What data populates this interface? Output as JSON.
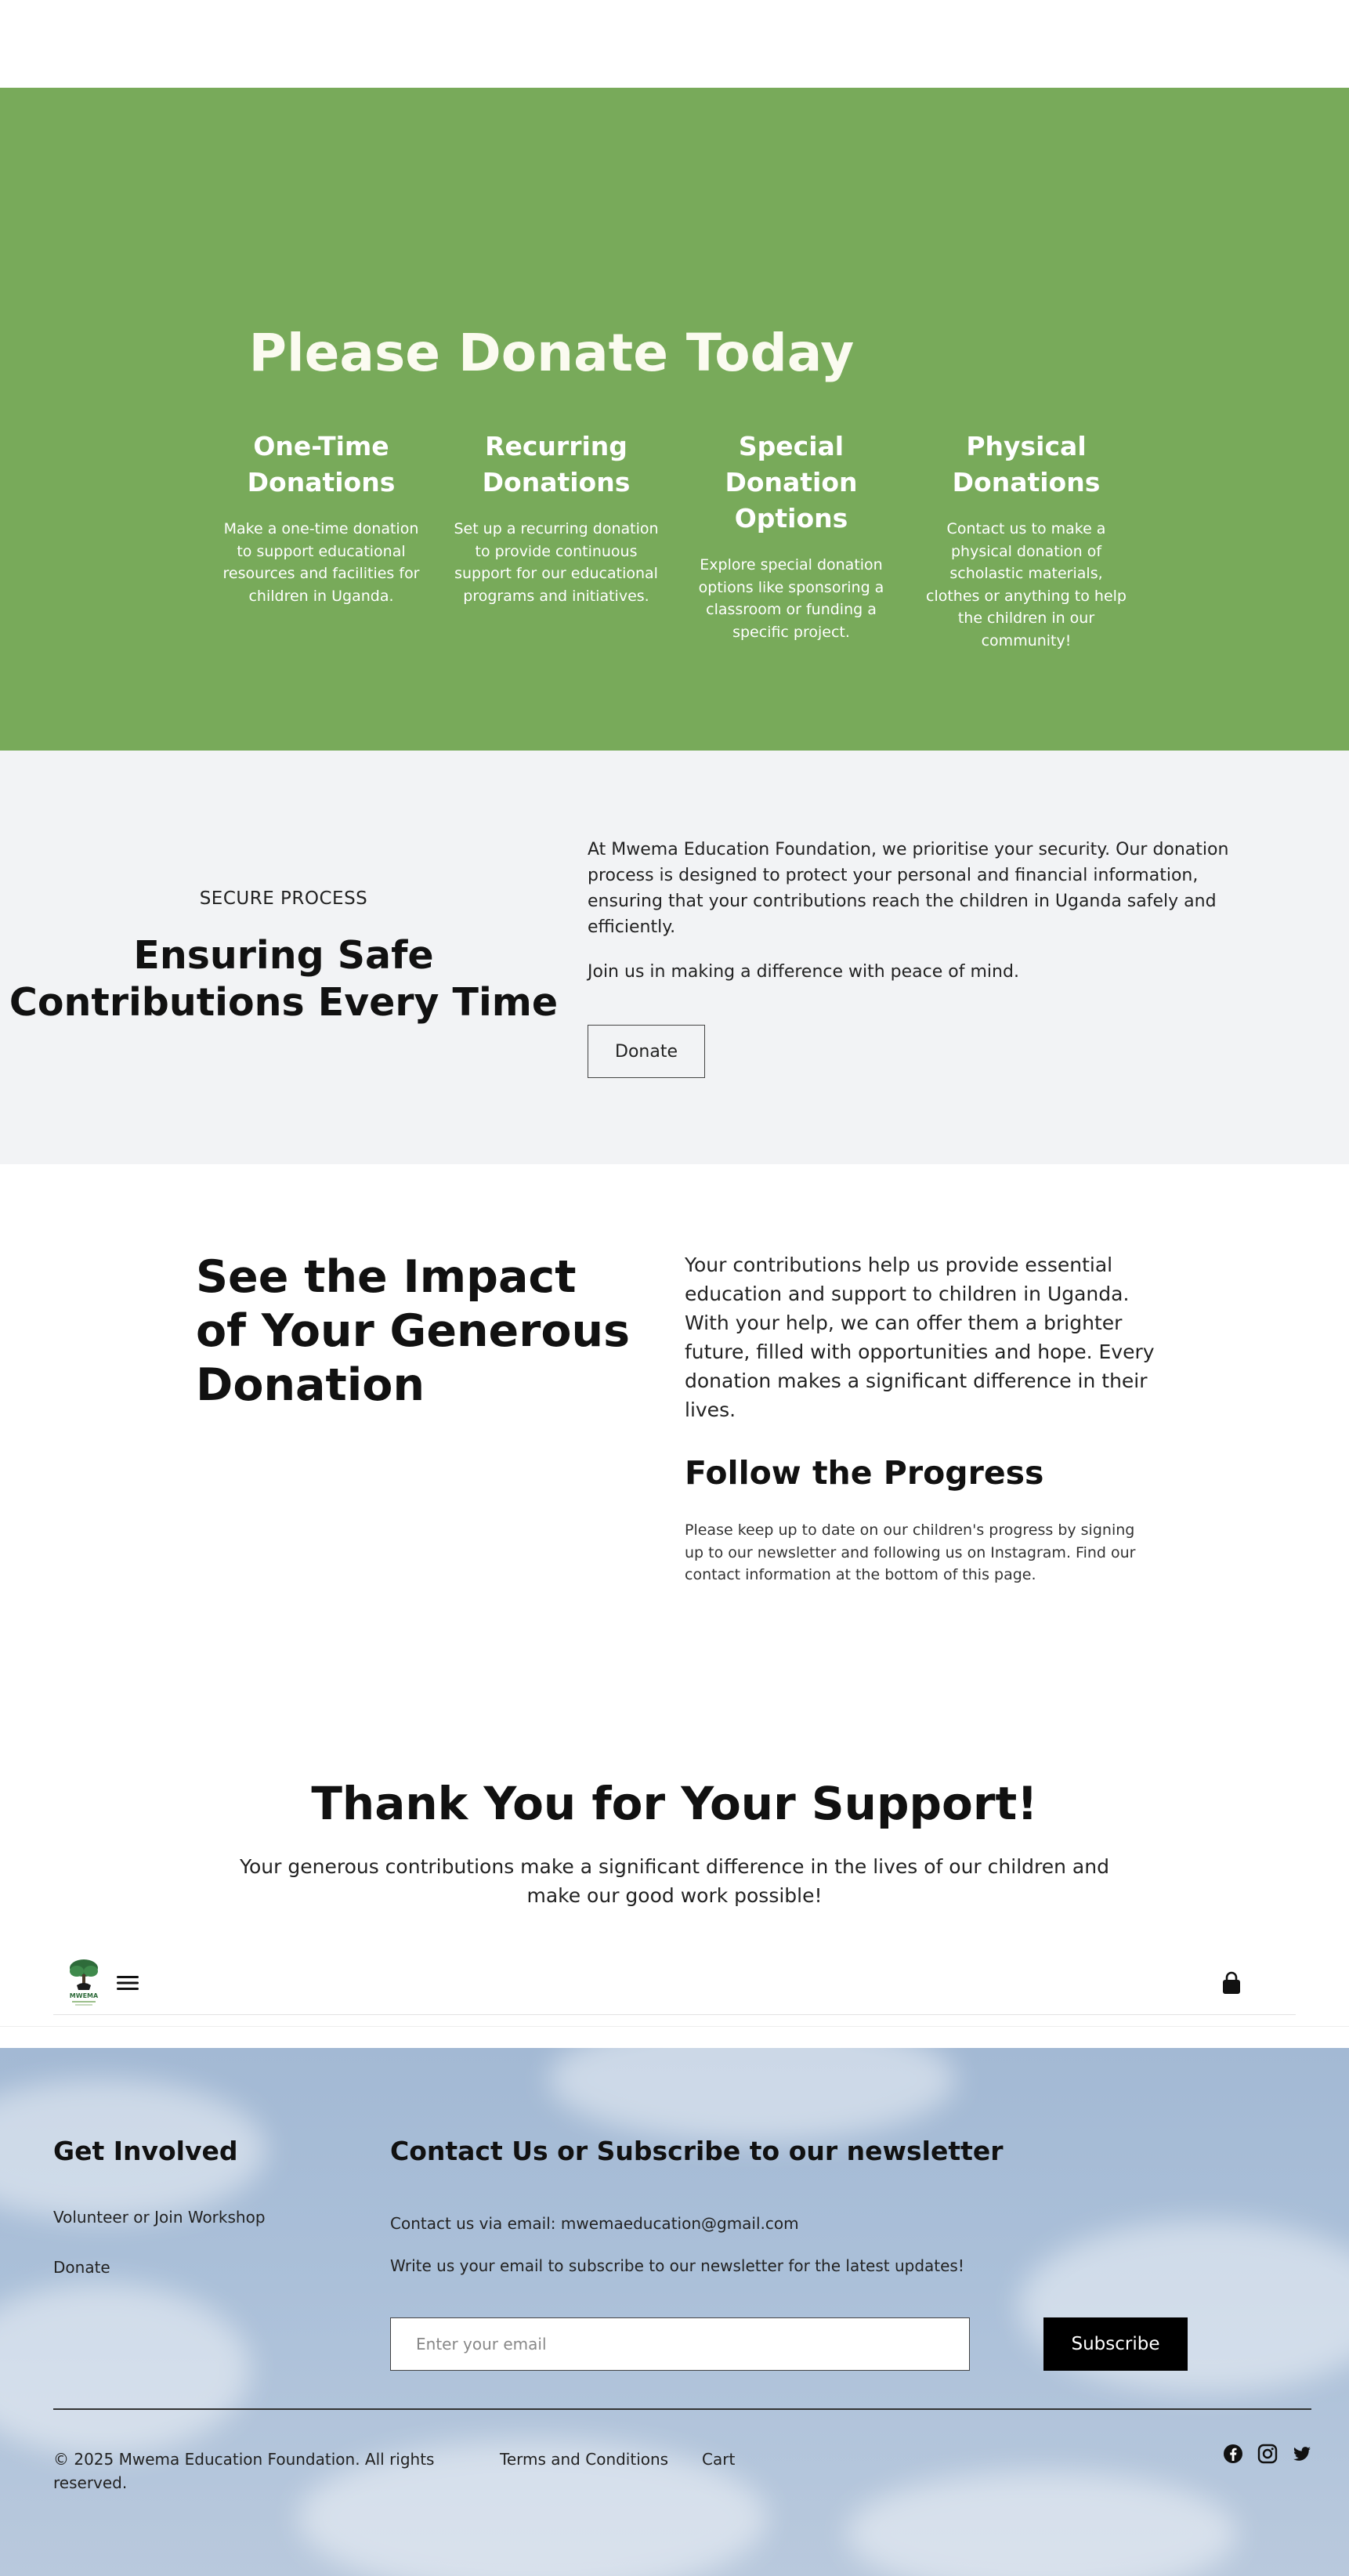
{
  "donate": {
    "title": "Please Donate Today",
    "bg_color": "#78aa5a",
    "options": [
      {
        "title": "One-Time Donations",
        "text": "Make a one-time donation to support educational resources and facilities for children in Uganda."
      },
      {
        "title": "Recurring Donations",
        "text": "Set up a recurring donation to provide continuous support for our educational programs and initiatives."
      },
      {
        "title": "Special Donation Options",
        "text": "Explore special donation options like sponsoring a classroom or funding a specific project."
      },
      {
        "title": "Physical Donations",
        "text": "Contact us to make a physical donation of scholastic materials, clothes or anything to help the children in our community!"
      }
    ]
  },
  "secure": {
    "label": "SECURE PROCESS",
    "title": "Ensuring Safe Contributions Every Time",
    "paragraph1": "At Mwema Education Foundation, we prioritise your security. Our donation process is designed to protect your personal and financial information, ensuring that your contributions reach the children in Uganda safely and efficiently.",
    "paragraph2": "Join us in making a difference with peace of mind.",
    "button_label": "Donate"
  },
  "impact": {
    "title": "See the Impact of Your Generous Donation",
    "body": "Your contributions help us provide essential education and support to children in Uganda. With your help, we can offer them a brighter future, filled with opportunities and hope. Every donation makes a significant difference in their lives.",
    "progress_title": "Follow the Progress",
    "progress_body": "Please keep up to date on our children's progress by signing up to our newsletter and following us on Instagram. Find our contact information at the bottom of this page."
  },
  "thanks": {
    "title": "Thank You for Your Support!",
    "body": "Your generous contributions make a significant difference in the lives of our children and make our good work possible!"
  },
  "mini_header": {
    "logo_text": "MWEMA",
    "menu_icon": "hamburger-menu-icon",
    "cart_icon": "shopping-bag-icon"
  },
  "footer": {
    "get_involved_title": "Get Involved",
    "links": [
      "Volunteer or Join Workshop",
      "Donate"
    ],
    "contact_title": "Contact Us or Subscribe to our newsletter",
    "contact_email_text": "Contact us via email: mwemaeducation@gmail.com",
    "subscribe_text": "Write us your email to subscribe to our newsletter for the latest updates!",
    "email_placeholder": "Enter your email",
    "subscribe_label": "Subscribe",
    "copyright": "© 2025 Mwema Education Foundation. All rights reserved.",
    "bottom_links": [
      "Terms and Conditions",
      "Cart"
    ],
    "social_icons": [
      "facebook-icon",
      "instagram-icon",
      "twitter-icon"
    ]
  }
}
